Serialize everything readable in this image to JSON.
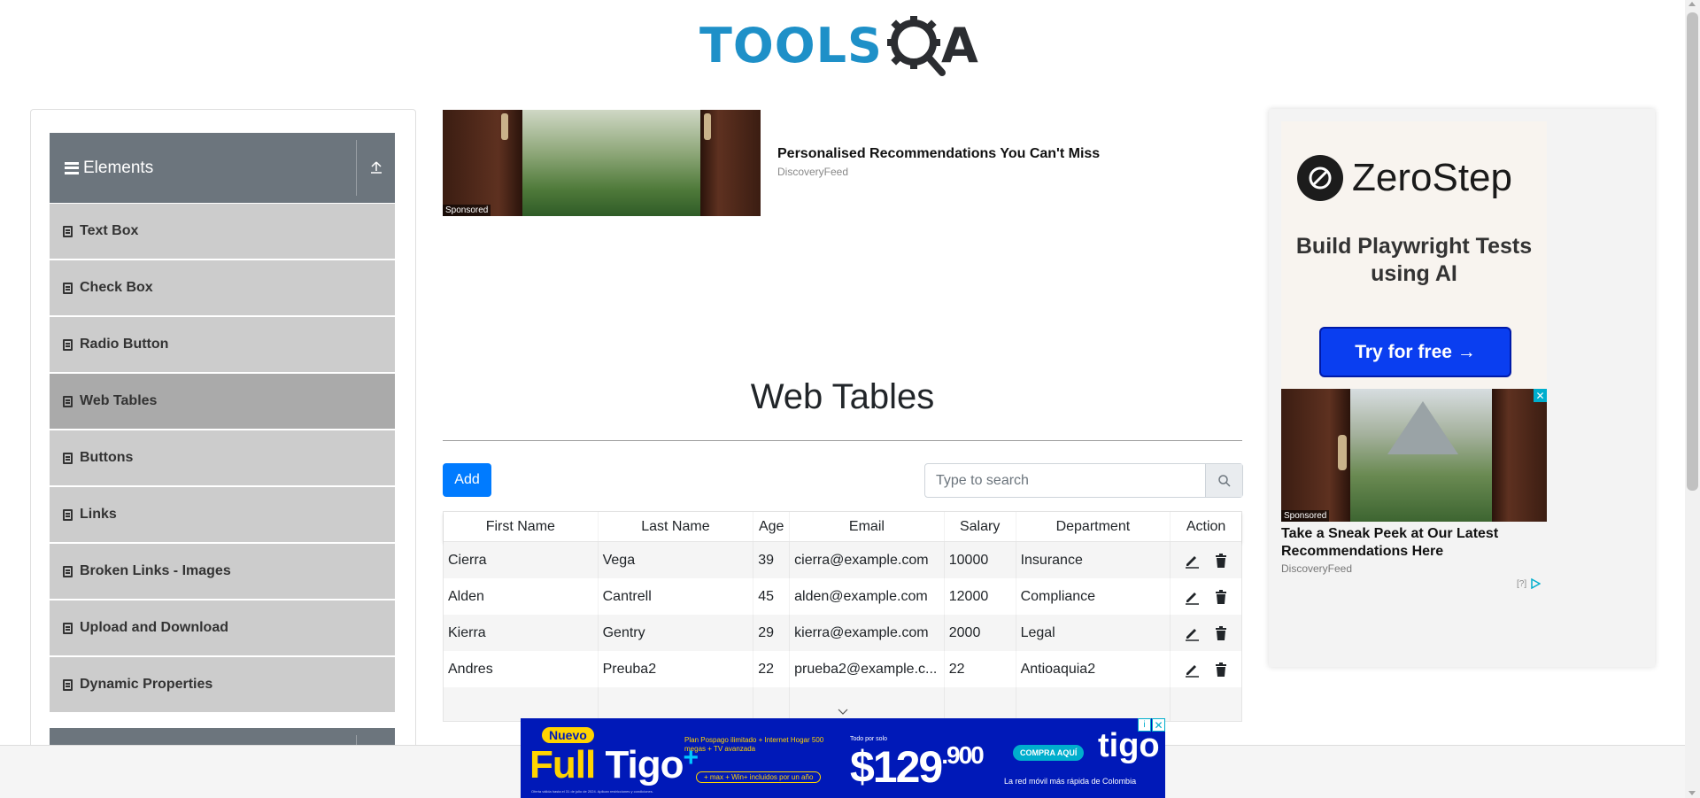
{
  "logo": {
    "left": "TOOLS",
    "right": "A"
  },
  "sidebar": {
    "group_title": "Elements",
    "items": [
      {
        "label": "Text Box",
        "active": false
      },
      {
        "label": "Check Box",
        "active": false
      },
      {
        "label": "Radio Button",
        "active": false
      },
      {
        "label": "Web Tables",
        "active": true
      },
      {
        "label": "Buttons",
        "active": false
      },
      {
        "label": "Links",
        "active": false
      },
      {
        "label": "Broken Links - Images",
        "active": false
      },
      {
        "label": "Upload and Download",
        "active": false
      },
      {
        "label": "Dynamic Properties",
        "active": false
      }
    ]
  },
  "top_ad": {
    "sponsored": "Sponsored",
    "title": "Personalised Recommendations You Can't Miss",
    "source": "DiscoveryFeed"
  },
  "main": {
    "title": "Web Tables",
    "add_label": "Add",
    "search_placeholder": "Type to search",
    "columns": [
      "First Name",
      "Last Name",
      "Age",
      "Email",
      "Salary",
      "Department",
      "Action"
    ],
    "rows": [
      [
        "Cierra",
        "Vega",
        "39",
        "cierra@example.com",
        "10000",
        "Insurance"
      ],
      [
        "Alden",
        "Cantrell",
        "45",
        "alden@example.com",
        "12000",
        "Compliance"
      ],
      [
        "Kierra",
        "Gentry",
        "29",
        "kierra@example.com",
        "2000",
        "Legal"
      ],
      [
        "Andres",
        "Preuba2",
        "22",
        "prueba2@example.c...",
        "22",
        "Antioaquia2"
      ]
    ]
  },
  "right_ad": {
    "brand": "ZeroStep",
    "subtitle": "Build Playwright Tests using AI",
    "cta": "Try for free →",
    "sponsored": "Sponsored",
    "close": "✕",
    "title": "Take a Sneak Peek at Our Latest Recommendations Here",
    "source": "DiscoveryFeed",
    "adchoice": "[?]"
  },
  "bottom_ad": {
    "nuevo": "Nuevo",
    "full": "Full",
    "tigo": "Tigo",
    "plus": "+",
    "features": "Plan Pospago ilimitado + Internet Hogar 500 megas + TV avanzada",
    "extras": "+ max + Win+ incluidos por un año",
    "todo": "Todo por solo",
    "price": "$129",
    "price_dec": ".900",
    "compra": "COMPRA AQUÍ",
    "logo": "tigo",
    "red": "La red móvil más rápida de Colombia",
    "legal": "Oferta válida hasta el 31 de julio de 2024. Aplican restricciones y condiciones.",
    "close": "✕",
    "info": "i"
  }
}
